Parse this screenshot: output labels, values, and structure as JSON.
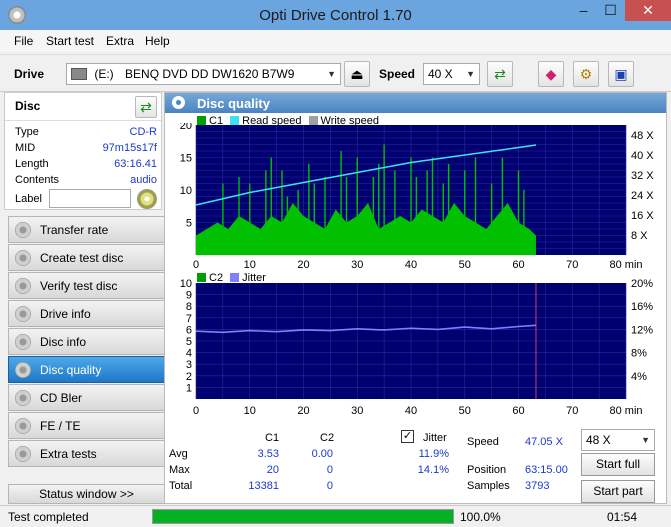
{
  "window": {
    "title": "Opti Drive Control 1.70",
    "minimize": "–",
    "maximize": "☐",
    "close": "✕"
  },
  "menu": {
    "items": [
      "File",
      "Start test",
      "Extra",
      "Help"
    ]
  },
  "drivebar": {
    "drive_label": "Drive",
    "drive_letter": "(E:)",
    "drive_name": "BENQ DVD DD DW1620 B7W9",
    "speed_label": "Speed",
    "speed_value": "40 X"
  },
  "disc": {
    "header": "Disc",
    "type_label": "Type",
    "type_value": "CD-R",
    "mid_label": "MID",
    "mid_value": "97m15s17f",
    "length_label": "Length",
    "length_value": "63:16.41",
    "contents_label": "Contents",
    "contents_value": "audio",
    "label_label": "Label",
    "label_value": ""
  },
  "nav": {
    "items": [
      "Transfer rate",
      "Create test disc",
      "Verify test disc",
      "Drive info",
      "Disc info",
      "Disc quality",
      "CD Bler",
      "FE / TE",
      "Extra tests"
    ],
    "active": "Disc quality",
    "status_window": "Status window >>"
  },
  "panel": {
    "title": "Disc quality"
  },
  "chart_data": [
    {
      "type": "area",
      "legend": [
        "C1",
        "Read speed",
        "Write speed"
      ],
      "colors": {
        "c1": "#00c000",
        "read": "#40e0f0",
        "write": "#a0a0a0",
        "bg": "#000070"
      },
      "x_ticks": [
        "0",
        "10",
        "20",
        "30",
        "40",
        "50",
        "60",
        "70",
        "80 min"
      ],
      "y_ticks": [
        "20",
        "15",
        "10",
        "5"
      ],
      "y2_ticks": [
        "48 X",
        "40 X",
        "32 X",
        "24 X",
        "16 X",
        "8 X"
      ],
      "xlim": [
        0,
        80
      ],
      "ylim": [
        0,
        20
      ],
      "data_end_min": 63.25,
      "c1_envelope": [
        [
          0,
          3
        ],
        [
          2,
          4
        ],
        [
          4,
          5
        ],
        [
          6,
          4
        ],
        [
          8,
          6
        ],
        [
          10,
          5
        ],
        [
          12,
          4
        ],
        [
          14,
          6
        ],
        [
          16,
          5
        ],
        [
          18,
          8
        ],
        [
          20,
          6
        ],
        [
          22,
          5
        ],
        [
          24,
          4
        ],
        [
          26,
          7
        ],
        [
          28,
          5
        ],
        [
          30,
          6
        ],
        [
          32,
          8
        ],
        [
          34,
          4
        ],
        [
          36,
          5
        ],
        [
          38,
          6
        ],
        [
          40,
          5
        ],
        [
          42,
          7
        ],
        [
          44,
          6
        ],
        [
          46,
          5
        ],
        [
          48,
          8
        ],
        [
          50,
          6
        ],
        [
          52,
          5
        ],
        [
          54,
          4
        ],
        [
          56,
          6
        ],
        [
          58,
          8
        ],
        [
          60,
          5
        ],
        [
          62,
          4
        ],
        [
          63.25,
          3
        ]
      ],
      "c1_peaks": [
        [
          5,
          11
        ],
        [
          8,
          12
        ],
        [
          10,
          11
        ],
        [
          13,
          13
        ],
        [
          14,
          15
        ],
        [
          16,
          13
        ],
        [
          17,
          9
        ],
        [
          19,
          10
        ],
        [
          21,
          14
        ],
        [
          22,
          11
        ],
        [
          24,
          12
        ],
        [
          27,
          16
        ],
        [
          28,
          12
        ],
        [
          30,
          15
        ],
        [
          33,
          12
        ],
        [
          34,
          14
        ],
        [
          35,
          17
        ],
        [
          37,
          13
        ],
        [
          40,
          15
        ],
        [
          41,
          12
        ],
        [
          43,
          13
        ],
        [
          44,
          15
        ],
        [
          46,
          11
        ],
        [
          47,
          14
        ],
        [
          50,
          13
        ],
        [
          52,
          15
        ],
        [
          55,
          11
        ],
        [
          57,
          15
        ],
        [
          60,
          13
        ],
        [
          61,
          10
        ]
      ],
      "read_speed": [
        [
          0,
          20
        ],
        [
          10,
          25
        ],
        [
          20,
          29
        ],
        [
          30,
          33
        ],
        [
          40,
          37
        ],
        [
          50,
          40
        ],
        [
          60,
          43
        ],
        [
          63.25,
          44
        ]
      ]
    },
    {
      "type": "line",
      "legend": [
        "C2",
        "Jitter"
      ],
      "colors": {
        "c2": "#00c000",
        "jitter": "#8080ff",
        "bg": "#000070"
      },
      "x_ticks": [
        "0",
        "10",
        "20",
        "30",
        "40",
        "50",
        "60",
        "70",
        "80 min"
      ],
      "y_ticks": [
        "10",
        "9",
        "8",
        "7",
        "6",
        "5",
        "4",
        "3",
        "2",
        "1"
      ],
      "y2_ticks": [
        "20%",
        "16%",
        "12%",
        "8%",
        "4%"
      ],
      "xlim": [
        0,
        80
      ],
      "ylim": [
        0,
        10
      ],
      "jitter_percent": [
        [
          0,
          11.7
        ],
        [
          5,
          11.5
        ],
        [
          10,
          11.8
        ],
        [
          15,
          11.6
        ],
        [
          20,
          11.9
        ],
        [
          25,
          11.8
        ],
        [
          30,
          12.1
        ],
        [
          35,
          11.9
        ],
        [
          40,
          12.2
        ],
        [
          45,
          12.0
        ],
        [
          50,
          12.4
        ],
        [
          55,
          12.1
        ],
        [
          60,
          12.5
        ],
        [
          63.25,
          12.7
        ]
      ]
    }
  ],
  "stats": {
    "col_c1": "C1",
    "col_c2": "C2",
    "jitter_label": "Jitter",
    "rows": [
      {
        "label": "Avg",
        "c1": "3.53",
        "c2": "0.00",
        "jitter": "11.9%"
      },
      {
        "label": "Max",
        "c1": "20",
        "c2": "0",
        "jitter": "14.1%"
      },
      {
        "label": "Total",
        "c1": "13381",
        "c2": "0",
        "jitter": ""
      }
    ],
    "speed_label": "Speed",
    "speed_value": "47.05 X",
    "position_label": "Position",
    "position_value": "63:15.00",
    "samples_label": "Samples",
    "samples_value": "3793",
    "speed_select": "48 X",
    "start_full": "Start full",
    "start_part": "Start part"
  },
  "status": {
    "text": "Test completed",
    "progress": 1.0,
    "percent": "100.0%",
    "time": "01:54"
  }
}
